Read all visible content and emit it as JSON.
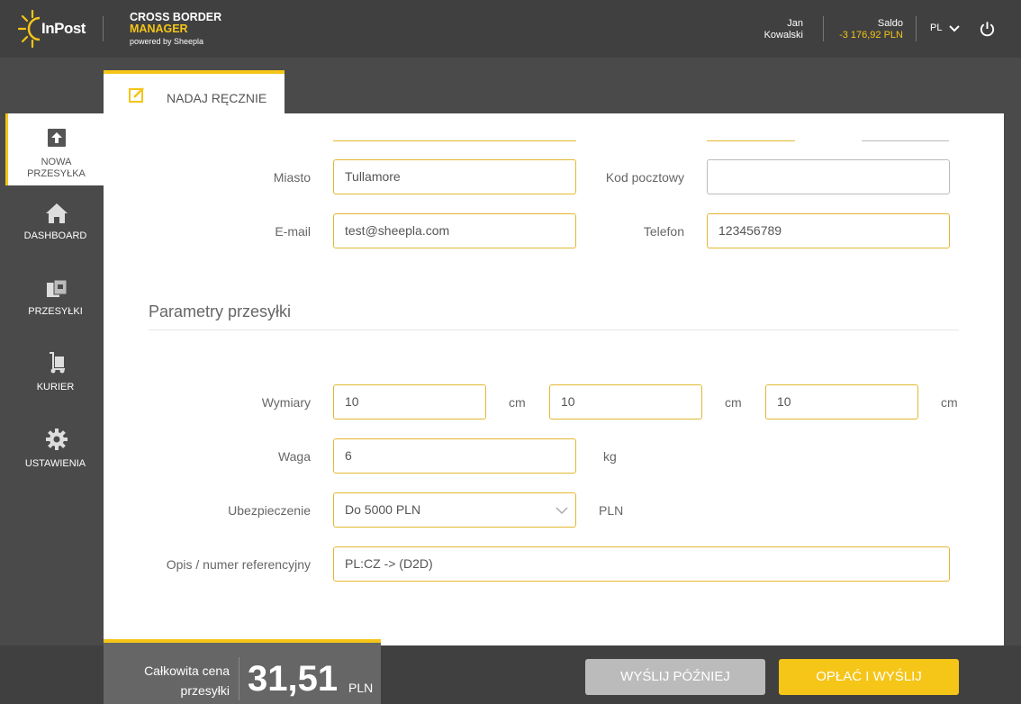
{
  "header": {
    "logo_text": "InPost",
    "brand_line1": "CROSS BORDER",
    "brand_line2": "MANAGER",
    "brand_line3": "powered by Sheepla",
    "user_first": "Jan",
    "user_last": "Kowalski",
    "saldo_label": "Saldo",
    "saldo_value": "-3 176,92 PLN",
    "language": "PL"
  },
  "sidebar": {
    "items": [
      {
        "label_line1": "NOWA",
        "label_line2": "PRZESYŁKA",
        "icon": "upload-icon",
        "active": true
      },
      {
        "label_line1": "DASHBOARD",
        "icon": "home-icon"
      },
      {
        "label_line1": "PRZESYŁKI",
        "icon": "boxes-icon"
      },
      {
        "label_line1": "KURIER",
        "icon": "courier-icon"
      },
      {
        "label_line1": "USTAWIENIA",
        "icon": "gear-icon"
      }
    ]
  },
  "tab": {
    "label": "NADAJ RĘCZNIE",
    "icon": "edit-icon"
  },
  "form": {
    "miasto": {
      "label": "Miasto",
      "value": "Tullamore"
    },
    "kod": {
      "label": "Kod pocztowy",
      "value": ""
    },
    "email": {
      "label": "E-mail",
      "value": "test@sheepla.com"
    },
    "telefon": {
      "label": "Telefon",
      "value": "123456789"
    },
    "section_title": "Parametry przesyłki",
    "wymiary": {
      "label": "Wymiary",
      "values": [
        "10",
        "10",
        "10"
      ],
      "unit": "cm"
    },
    "waga": {
      "label": "Waga",
      "value": "6",
      "unit": "kg"
    },
    "ubezpieczenie": {
      "label": "Ubezpieczenie",
      "value": "Do 5000 PLN",
      "unit": "PLN"
    },
    "opis": {
      "label": "Opis / numer referencyjny",
      "value": "PL:CZ -> (D2D)"
    }
  },
  "footer": {
    "price_label_line1": "Całkowita cena",
    "price_label_line2": "przesyłki",
    "price_value": "31,51",
    "price_currency": "PLN",
    "btn_later": "WYŚLIJ PÓŹNIEJ",
    "btn_pay": "OPŁAĆ I WYŚLIJ"
  },
  "colors": {
    "accent": "#f5c518",
    "header_bg": "#404040",
    "body_bg": "#4a4a4a"
  }
}
